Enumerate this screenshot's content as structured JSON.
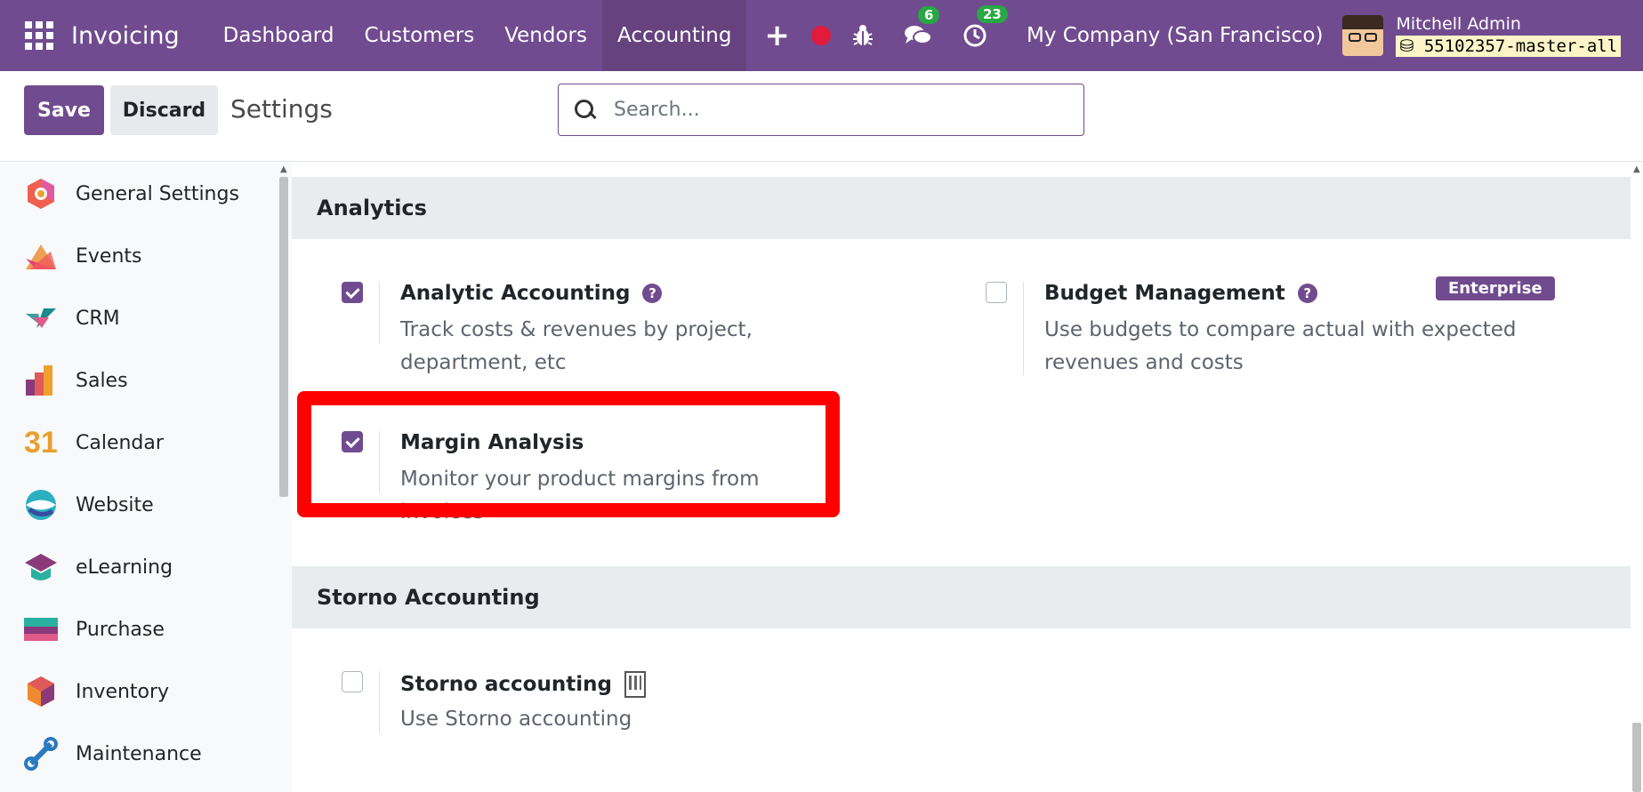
{
  "navbar": {
    "brand": "Invoicing",
    "menu": [
      "Dashboard",
      "Customers",
      "Vendors",
      "Accounting"
    ],
    "active_index": 3,
    "plus_label": "+",
    "messages_count": "6",
    "activities_count": "23",
    "company": "My Company (San Francisco)",
    "user_name": "Mitchell Admin",
    "database": "55102357-master-all"
  },
  "control_panel": {
    "save_label": "Save",
    "discard_label": "Discard",
    "title": "Settings",
    "search_placeholder": "Search..."
  },
  "sidebar": {
    "items": [
      {
        "label": "General Settings",
        "icon": "general-settings-icon"
      },
      {
        "label": "Events",
        "icon": "events-icon"
      },
      {
        "label": "CRM",
        "icon": "crm-icon"
      },
      {
        "label": "Sales",
        "icon": "sales-icon"
      },
      {
        "label": "Calendar",
        "icon": "calendar-icon"
      },
      {
        "label": "Website",
        "icon": "website-icon"
      },
      {
        "label": "eLearning",
        "icon": "elearning-icon"
      },
      {
        "label": "Purchase",
        "icon": "purchase-icon"
      },
      {
        "label": "Inventory",
        "icon": "inventory-icon"
      },
      {
        "label": "Maintenance",
        "icon": "maintenance-icon"
      }
    ],
    "calendar_icon_text": "31"
  },
  "sections": {
    "analytics": {
      "title": "Analytics",
      "analytic_accounting": {
        "title": "Analytic Accounting",
        "desc": "Track costs & revenues by project, department, etc",
        "checked": true
      },
      "budget_management": {
        "title": "Budget Management",
        "desc": "Use budgets to compare actual with expected revenues and costs",
        "checked": false,
        "badge": "Enterprise"
      },
      "margin_analysis": {
        "title": "Margin Analysis",
        "desc": "Monitor your product margins from invoices",
        "checked": true
      }
    },
    "storno": {
      "title": "Storno Accounting",
      "storno_accounting": {
        "title": "Storno accounting",
        "desc": "Use Storno accounting",
        "checked": false
      }
    }
  },
  "help_glyph": "?",
  "colors": {
    "brand": "#714b8f",
    "highlight": "#ff0000",
    "badge_green": "#28a745"
  }
}
